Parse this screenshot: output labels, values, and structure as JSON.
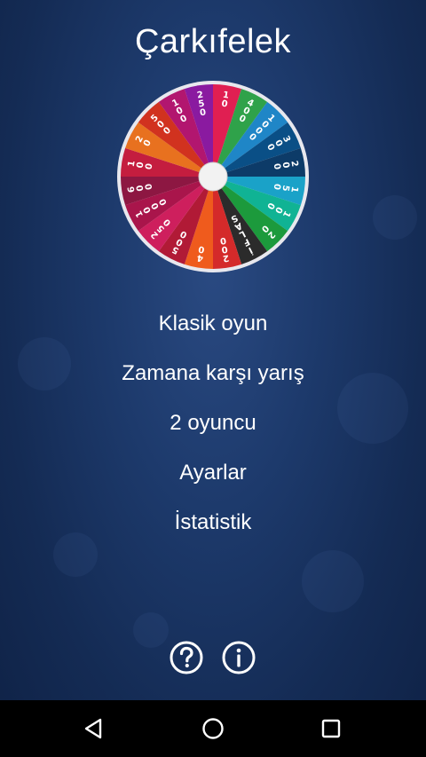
{
  "app": {
    "title": "Çarkıfelek"
  },
  "wheel": {
    "segments": [
      {
        "value": "10",
        "color": "#e01f52"
      },
      {
        "value": "400",
        "color": "#2fa24a"
      },
      {
        "value": "1000",
        "color": "#1f86c7"
      },
      {
        "value": "300",
        "color": "#0a4f86"
      },
      {
        "value": "200",
        "color": "#0d3b68"
      },
      {
        "value": "150",
        "color": "#1aa2c8"
      },
      {
        "value": "100",
        "color": "#10b394"
      },
      {
        "value": "20",
        "color": "#1c9a3c"
      },
      {
        "value": "İFLAS",
        "color": "#2b2b2b"
      },
      {
        "value": "200",
        "color": "#d42a2a"
      },
      {
        "value": "40",
        "color": "#ef5b1d"
      },
      {
        "value": "500",
        "color": "#b11a36"
      },
      {
        "value": "250",
        "color": "#ce1f5d"
      },
      {
        "value": "1000",
        "color": "#a9154b"
      },
      {
        "value": "600",
        "color": "#8d1742"
      },
      {
        "value": "100",
        "color": "#c41d3f"
      },
      {
        "value": "20",
        "color": "#e8711f"
      },
      {
        "value": "500",
        "color": "#d1321f"
      },
      {
        "value": "100",
        "color": "#b2166f"
      },
      {
        "value": "250",
        "color": "#8a1aa0"
      }
    ]
  },
  "menu": {
    "items": [
      {
        "label": "Klasik oyun"
      },
      {
        "label": "Zamana karşı yarış"
      },
      {
        "label": "2 oyuncu"
      },
      {
        "label": "Ayarlar"
      },
      {
        "label": "İstatistik"
      }
    ]
  },
  "footer": {
    "help_icon": "question-circle",
    "info_icon": "info-circle"
  },
  "navbar": {
    "back_icon": "triangle-back",
    "home_icon": "circle-home",
    "recents_icon": "square-recents"
  }
}
